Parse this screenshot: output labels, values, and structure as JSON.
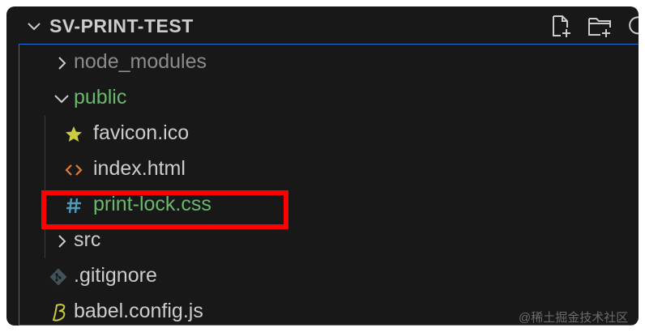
{
  "explorer": {
    "section_title": "SV-PRINT-TEST",
    "header_actions": [
      "new-file-icon",
      "new-folder-icon",
      "refresh-icon"
    ]
  },
  "tree": {
    "items": [
      {
        "label": "node_modules",
        "kind": "folder",
        "state": "collapsed",
        "color": "#8c8c8c"
      },
      {
        "label": "public",
        "kind": "folder",
        "state": "expanded",
        "color": "#6ab76d"
      },
      {
        "label": "favicon.ico",
        "kind": "file",
        "icon": "star-icon",
        "color": "#cccccc"
      },
      {
        "label": "index.html",
        "kind": "file",
        "icon": "html-brackets-icon",
        "color": "#cccccc"
      },
      {
        "label": "print-lock.css",
        "kind": "file",
        "icon": "css-hash-icon",
        "color": "#6ab76d",
        "highlighted": true
      },
      {
        "label": "src",
        "kind": "folder",
        "state": "collapsed",
        "color": "#cccccc"
      },
      {
        "label": ".gitignore",
        "kind": "file",
        "icon": "git-icon",
        "color": "#cccccc"
      },
      {
        "label": "babel.config.js",
        "kind": "file",
        "icon": "babel-icon",
        "color": "#cccccc"
      }
    ]
  },
  "colors": {
    "panel_bg": "#181818",
    "focus_border": "#1f6fd6",
    "annotation": "#ff0000",
    "git_status_green": "#6ab76d"
  },
  "watermark": "@稀土掘金技术社区"
}
